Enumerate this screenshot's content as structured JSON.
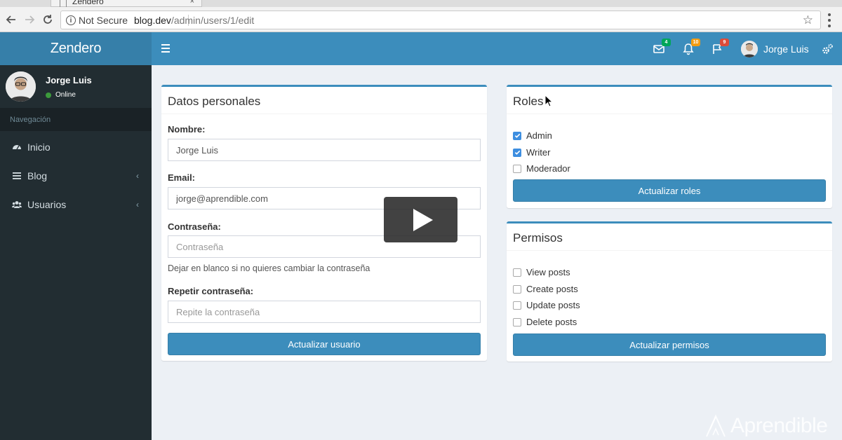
{
  "browser": {
    "tab_title": "Zendero",
    "tab_close": "×",
    "security_label": "Not Secure",
    "url_host": "blog.dev",
    "url_path": "/admin/users/1/edit"
  },
  "app": {
    "logo": "Zendero",
    "header": {
      "messages_count": "4",
      "notifications_count": "10",
      "flags_count": "9",
      "user_name": "Jorge Luis",
      "colors": {
        "messages_badge": "#00a65a",
        "notifications_badge": "#f39c12",
        "flags_badge": "#dd4b39"
      }
    }
  },
  "sidebar": {
    "user_name": "Jorge Luis",
    "status": "Online",
    "nav_header": "Navegación",
    "items": [
      {
        "label": "Inicio",
        "icon": "dashboard-icon"
      },
      {
        "label": "Blog",
        "icon": "list-icon",
        "chevron": "‹"
      },
      {
        "label": "Usuarios",
        "icon": "users-icon",
        "chevron": "‹"
      }
    ]
  },
  "personal": {
    "title": "Datos personales",
    "name_label": "Nombre:",
    "name_value": "Jorge Luis",
    "email_label": "Email:",
    "email_value": "jorge@aprendible.com",
    "password_label": "Contraseña:",
    "password_placeholder": "Contraseña",
    "password_help": "Dejar en blanco si no quieres cambiar la contraseña",
    "repeat_label": "Repetir contraseña:",
    "repeat_placeholder": "Repite la contraseña",
    "submit": "Actualizar usuario"
  },
  "roles": {
    "title": "Roles",
    "items": [
      {
        "label": "Admin",
        "checked": true
      },
      {
        "label": "Writer",
        "checked": true
      },
      {
        "label": "Moderador",
        "checked": false
      }
    ],
    "submit": "Actualizar roles"
  },
  "permisos": {
    "title": "Permisos",
    "items": [
      {
        "label": "View posts",
        "checked": false
      },
      {
        "label": "Create posts",
        "checked": false
      },
      {
        "label": "Update posts",
        "checked": false
      },
      {
        "label": "Delete posts",
        "checked": false
      }
    ],
    "submit": "Actualizar permisos"
  },
  "watermark": "Aprendible",
  "colors": {
    "primary": "#3c8dbc",
    "primary_dark": "#367fa9",
    "sidebar": "#222d32",
    "content_bg": "#ecf0f5"
  }
}
